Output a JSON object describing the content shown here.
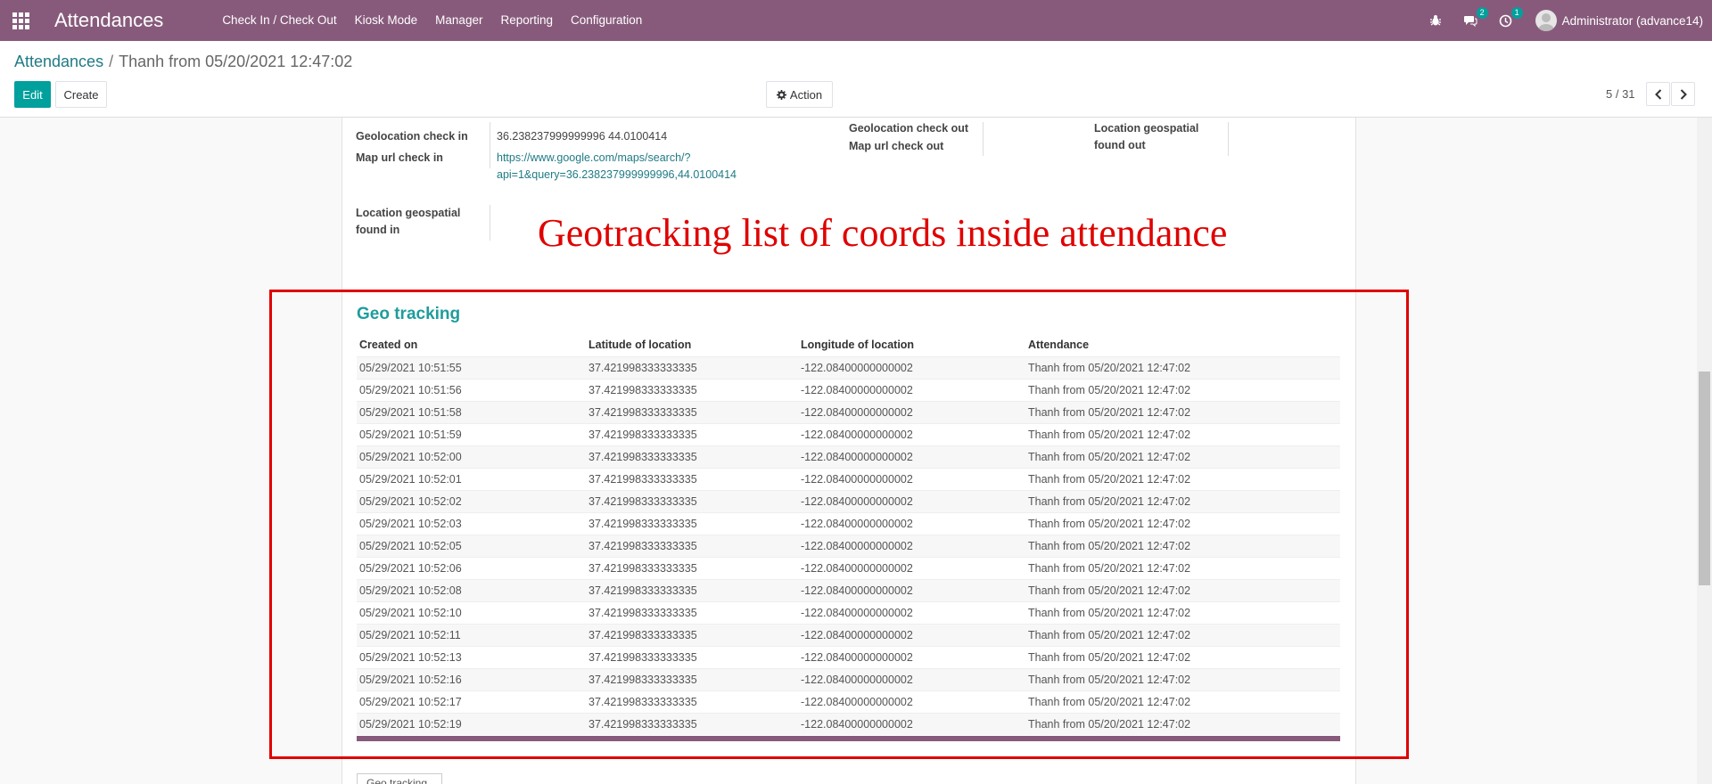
{
  "navbar": {
    "app_title": "Attendances",
    "menu": [
      "Check In / Check Out",
      "Kiosk Mode",
      "Manager",
      "Reporting",
      "Configuration"
    ],
    "messages_count": "2",
    "activities_count": "1",
    "user": "Administrator (advance14)",
    "bg_color": "#875A7B"
  },
  "breadcrumb": {
    "parent": "Attendances",
    "current": "Thanh from 05/20/2021 12:47:02"
  },
  "buttons": {
    "edit": "Edit",
    "create": "Create",
    "action": "Action"
  },
  "pager": {
    "value": "5 / 31"
  },
  "form": {
    "geolocation_check_in_label": "Geolocation check in",
    "geolocation_check_in_value": "36.238237999999996 44.0100414",
    "map_url_check_in_label": "Map url check in",
    "map_url_line1": "https://www.google.com/maps/search/?",
    "map_url_line2": "api=1&query=36.238237999999996,44.0100414",
    "geolocation_check_out_label": "Geolocation check out",
    "map_url_check_out_label": "Map url check out",
    "location_found_out_line1": "Location geospatial",
    "location_found_out_line2": "found out",
    "location_found_in_line1": "Location geospatial",
    "location_found_in_line2": "found in"
  },
  "annotation": "Geotracking list of coords inside attendance",
  "geo_tracking": {
    "title": "Geo tracking",
    "columns": [
      "Created on",
      "Latitude of location",
      "Longitude of location",
      "Attendance"
    ],
    "rows": [
      [
        "05/29/2021 10:51:55",
        "37.421998333333335",
        "-122.08400000000002",
        "Thanh from 05/20/2021 12:47:02"
      ],
      [
        "05/29/2021 10:51:56",
        "37.421998333333335",
        "-122.08400000000002",
        "Thanh from 05/20/2021 12:47:02"
      ],
      [
        "05/29/2021 10:51:58",
        "37.421998333333335",
        "-122.08400000000002",
        "Thanh from 05/20/2021 12:47:02"
      ],
      [
        "05/29/2021 10:51:59",
        "37.421998333333335",
        "-122.08400000000002",
        "Thanh from 05/20/2021 12:47:02"
      ],
      [
        "05/29/2021 10:52:00",
        "37.421998333333335",
        "-122.08400000000002",
        "Thanh from 05/20/2021 12:47:02"
      ],
      [
        "05/29/2021 10:52:01",
        "37.421998333333335",
        "-122.08400000000002",
        "Thanh from 05/20/2021 12:47:02"
      ],
      [
        "05/29/2021 10:52:02",
        "37.421998333333335",
        "-122.08400000000002",
        "Thanh from 05/20/2021 12:47:02"
      ],
      [
        "05/29/2021 10:52:03",
        "37.421998333333335",
        "-122.08400000000002",
        "Thanh from 05/20/2021 12:47:02"
      ],
      [
        "05/29/2021 10:52:05",
        "37.421998333333335",
        "-122.08400000000002",
        "Thanh from 05/20/2021 12:47:02"
      ],
      [
        "05/29/2021 10:52:06",
        "37.421998333333335",
        "-122.08400000000002",
        "Thanh from 05/20/2021 12:47:02"
      ],
      [
        "05/29/2021 10:52:08",
        "37.421998333333335",
        "-122.08400000000002",
        "Thanh from 05/20/2021 12:47:02"
      ],
      [
        "05/29/2021 10:52:10",
        "37.421998333333335",
        "-122.08400000000002",
        "Thanh from 05/20/2021 12:47:02"
      ],
      [
        "05/29/2021 10:52:11",
        "37.421998333333335",
        "-122.08400000000002",
        "Thanh from 05/20/2021 12:47:02"
      ],
      [
        "05/29/2021 10:52:13",
        "37.421998333333335",
        "-122.08400000000002",
        "Thanh from 05/20/2021 12:47:02"
      ],
      [
        "05/29/2021 10:52:16",
        "37.421998333333335",
        "-122.08400000000002",
        "Thanh from 05/20/2021 12:47:02"
      ],
      [
        "05/29/2021 10:52:17",
        "37.421998333333335",
        "-122.08400000000002",
        "Thanh from 05/20/2021 12:47:02"
      ],
      [
        "05/29/2021 10:52:19",
        "37.421998333333335",
        "-122.08400000000002",
        "Thanh from 05/20/2021 12:47:02"
      ]
    ]
  },
  "bottom_button": "Geo tracking"
}
